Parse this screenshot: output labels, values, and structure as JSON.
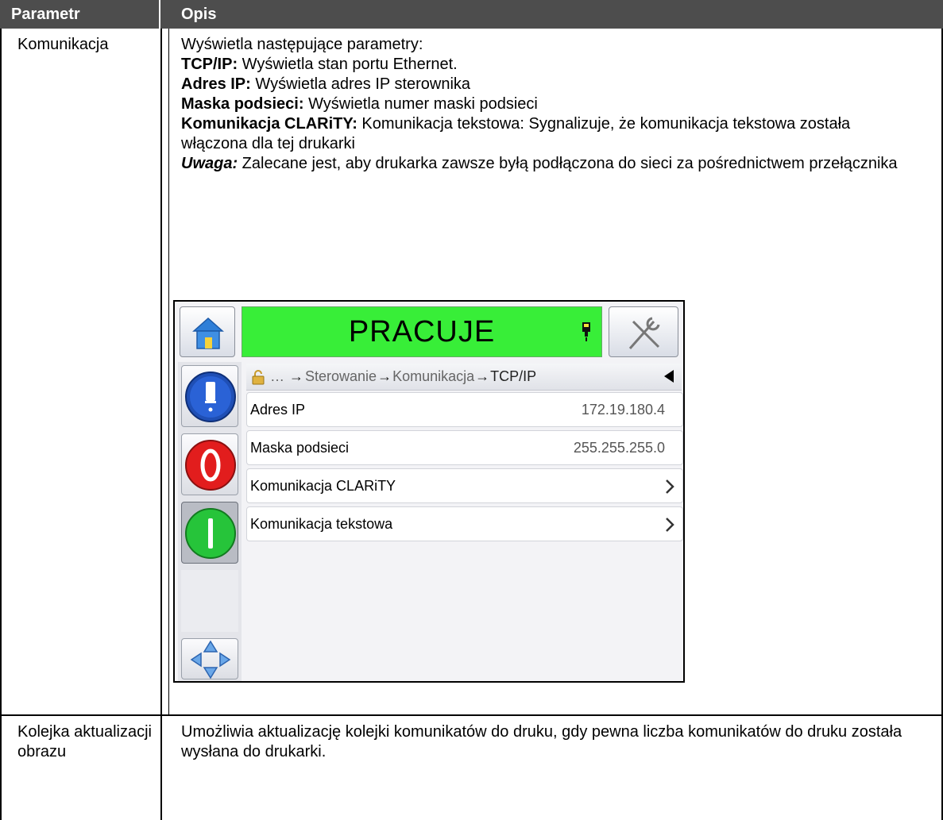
{
  "table": {
    "headers": {
      "param": "Parametr",
      "desc": "Opis"
    },
    "rows": [
      {
        "param": "Komunikacja",
        "intro": "Wyświetla następujące parametry:",
        "items": [
          {
            "label": "TCP/IP:",
            "text": " Wyświetla stan portu Ethernet."
          },
          {
            "label": "Adres IP:",
            "text": " Wyświetla adres IP sterownika"
          },
          {
            "label": "Maska podsieci:",
            "text": " Wyświetla numer maski podsieci"
          },
          {
            "label": "Komunikacja CLARiTY:",
            "text": " Komunikacja tekstowa: Sygnalizuje, że komunikacja tekstowa została włączona dla tej drukarki"
          }
        ],
        "note_label": "Uwaga:",
        "note_text": " Zalecane jest, aby drukarka zawsze byłą podłączona do sieci za pośrednictwem przełącznika"
      },
      {
        "param": "Kolejka aktualizacji obrazu",
        "desc": "Umożliwia aktualizację kolejki komunikatów do druku, gdy pewna liczba komunikatów do druku została wysłana do drukarki."
      }
    ]
  },
  "device": {
    "status": "PRACUJE",
    "status_color": "#38ee38",
    "breadcrumb": {
      "prefix": "…",
      "items": [
        "Sterowanie",
        "Komunikacja",
        "TCP/IP"
      ],
      "arrow": "→"
    },
    "rows": [
      {
        "label": "Adres IP",
        "value": "172.19.180.4"
      },
      {
        "label": "Maska podsieci",
        "value": "255.255.255.0"
      },
      {
        "label": "Komunikacja CLARiTY"
      },
      {
        "label": "Komunikacja tekstowa"
      }
    ],
    "icons": [
      "home-icon",
      "tools-icon",
      "ink-bottle-icon",
      "stop-icon",
      "start-icon",
      "navigate-icon",
      "lock-icon",
      "back-icon",
      "chevron-right-icon",
      "printhead-icon"
    ]
  }
}
